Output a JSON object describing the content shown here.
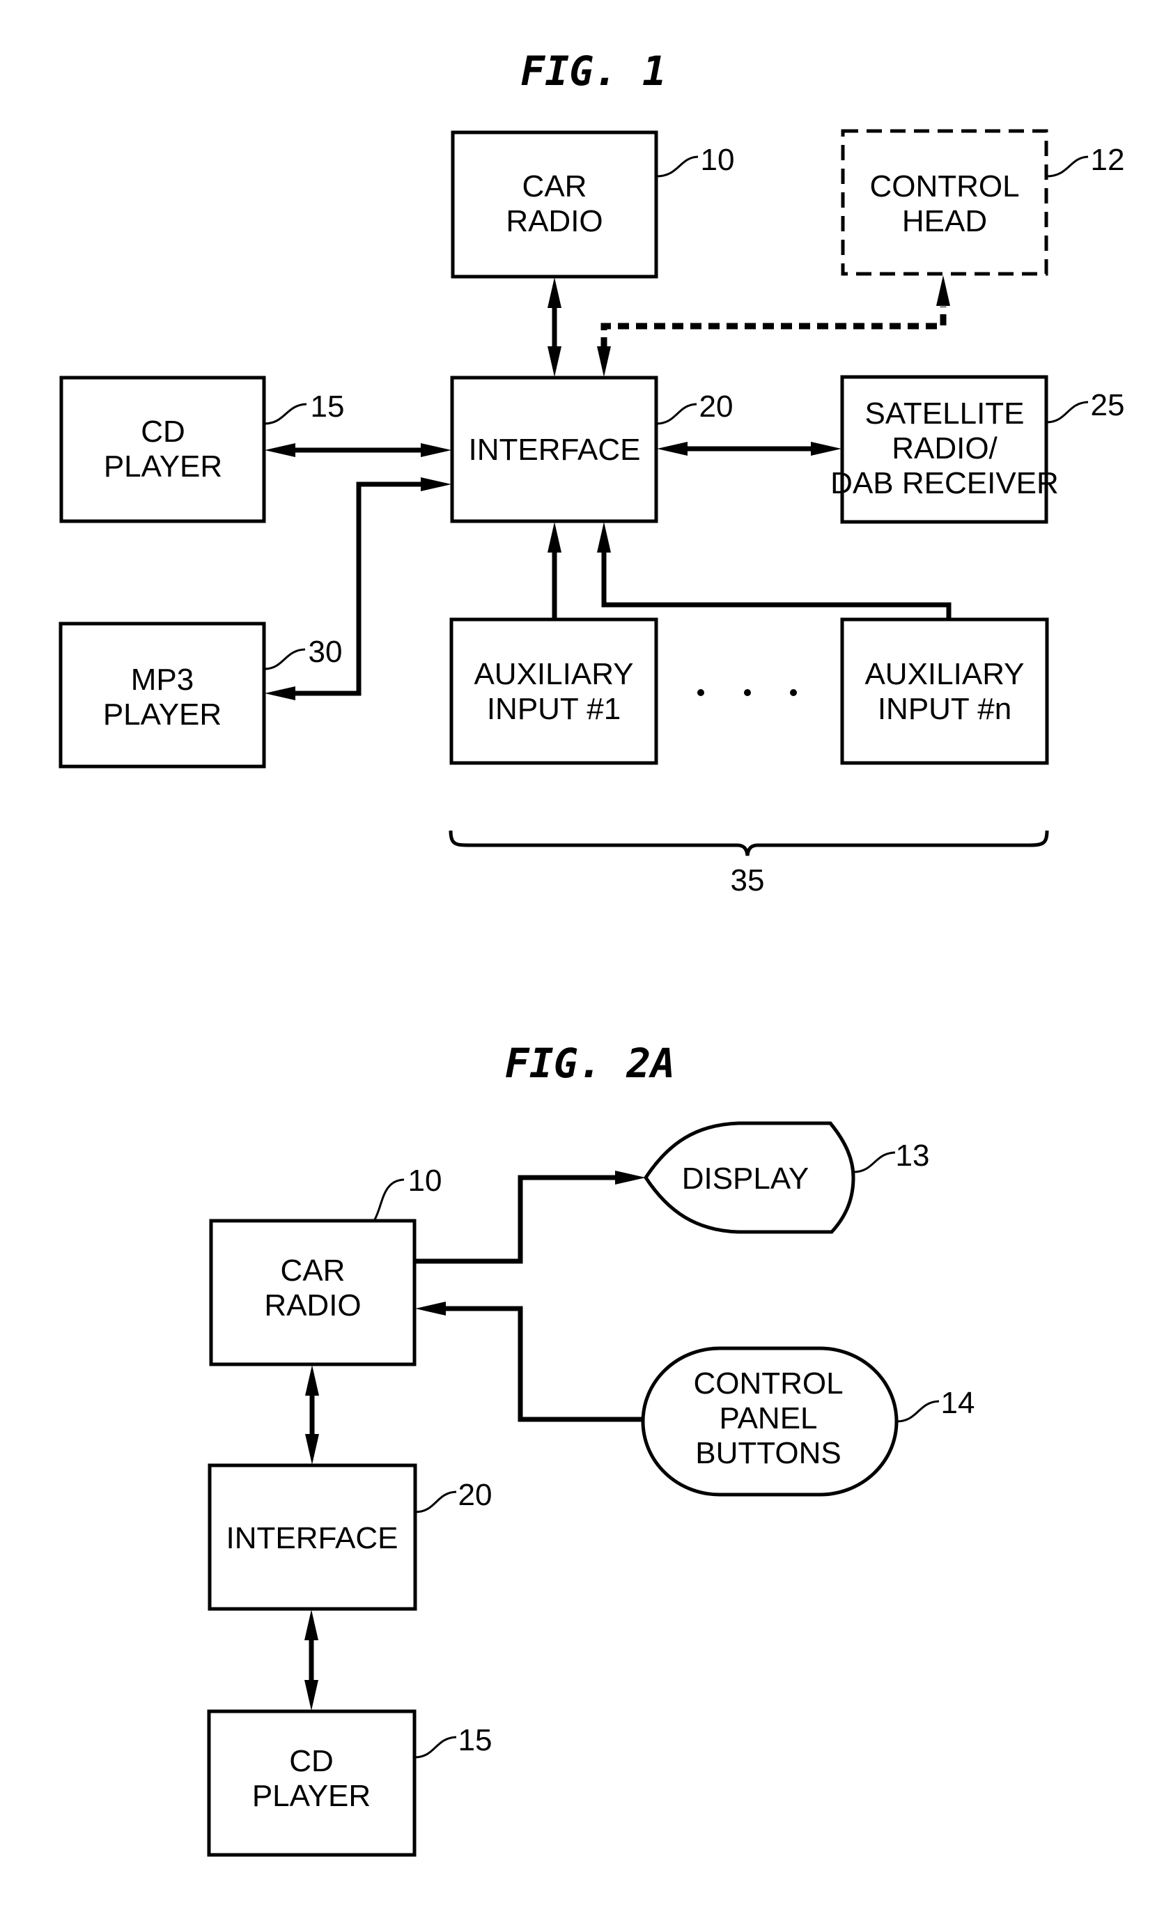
{
  "figures": [
    {
      "id": "fig1",
      "title": "FIG. 1",
      "blocks": {
        "car_radio": {
          "lines": [
            "CAR",
            "RADIO"
          ],
          "ref": "10",
          "style": "solid"
        },
        "control_head": {
          "lines": [
            "CONTROL",
            "HEAD"
          ],
          "ref": "12",
          "style": "dashed"
        },
        "cd_player": {
          "lines": [
            "CD",
            "PLAYER"
          ],
          "ref": "15",
          "style": "solid"
        },
        "interface": {
          "lines": [
            "INTERFACE"
          ],
          "ref": "20",
          "style": "solid"
        },
        "satellite": {
          "lines": [
            "SATELLITE",
            "RADIO/",
            "DAB RECEIVER"
          ],
          "ref": "25",
          "style": "solid"
        },
        "mp3_player": {
          "lines": [
            "MP3",
            "PLAYER"
          ],
          "ref": "30",
          "style": "solid"
        },
        "aux1": {
          "lines": [
            "AUXILIARY",
            "INPUT #1"
          ],
          "style": "solid"
        },
        "auxn": {
          "lines": [
            "AUXILIARY",
            "INPUT #n"
          ],
          "style": "solid"
        }
      },
      "group_ref": "35",
      "ellipsis": "· · ·",
      "connections": [
        {
          "from": "car_radio",
          "to": "interface",
          "type": "bidirectional"
        },
        {
          "from": "interface",
          "to": "control_head",
          "type": "bidirectional-dashed"
        },
        {
          "from": "cd_player",
          "to": "interface",
          "type": "bidirectional"
        },
        {
          "from": "mp3_player",
          "to": "interface",
          "type": "bidirectional"
        },
        {
          "from": "interface",
          "to": "satellite",
          "type": "bidirectional"
        },
        {
          "from": "aux1",
          "to": "interface",
          "type": "directed"
        },
        {
          "from": "auxn",
          "to": "interface",
          "type": "directed"
        }
      ]
    },
    {
      "id": "fig2a",
      "title": "FIG. 2A",
      "blocks": {
        "car_radio": {
          "lines": [
            "CAR",
            "RADIO"
          ],
          "ref": "10",
          "style": "solid"
        },
        "display": {
          "lines": [
            "DISPLAY"
          ],
          "ref": "13",
          "style": "display-shape"
        },
        "control_panel": {
          "lines": [
            "CONTROL",
            "PANEL",
            "BUTTONS"
          ],
          "ref": "14",
          "style": "rounded"
        },
        "interface": {
          "lines": [
            "INTERFACE"
          ],
          "ref": "20",
          "style": "solid"
        },
        "cd_player": {
          "lines": [
            "CD",
            "PLAYER"
          ],
          "ref": "15",
          "style": "solid"
        }
      },
      "connections": [
        {
          "from": "car_radio",
          "to": "display",
          "type": "directed"
        },
        {
          "from": "control_panel",
          "to": "car_radio",
          "type": "directed"
        },
        {
          "from": "car_radio",
          "to": "interface",
          "type": "bidirectional"
        },
        {
          "from": "interface",
          "to": "cd_player",
          "type": "bidirectional"
        }
      ]
    }
  ]
}
